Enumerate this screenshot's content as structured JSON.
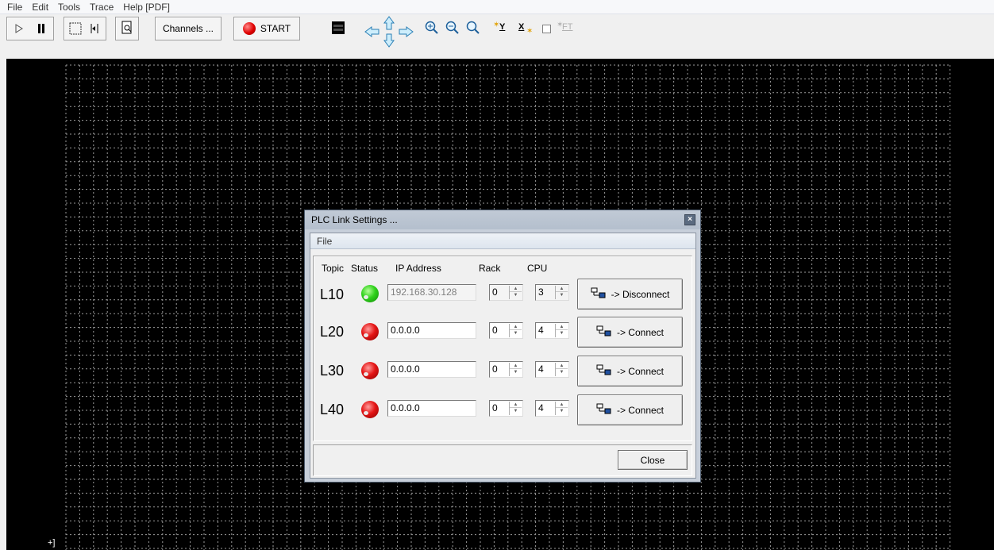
{
  "menu": {
    "items": [
      "File",
      "Edit",
      "Tools",
      "Trace",
      "Help [PDF]"
    ]
  },
  "toolbar": {
    "channels_label": "Channels ...",
    "start_label": "START",
    "y_label": "Y",
    "x_label": "X",
    "ft_label": "FT"
  },
  "plot": {
    "corner_label": "+]"
  },
  "dialog": {
    "title": "PLC Link Settings ...",
    "menu_file": "File",
    "headers": {
      "topic": "Topic",
      "status": "Status",
      "ip": "IP Address",
      "rack": "Rack",
      "cpu": "CPU"
    },
    "rows": [
      {
        "topic": "L10",
        "status": "connected",
        "ip": "192.168.30.128",
        "rack": "0",
        "cpu": "3",
        "button": "-> Disconnect"
      },
      {
        "topic": "L20",
        "status": "disconnected",
        "ip": "0.0.0.0",
        "rack": "0",
        "cpu": "4",
        "button": "-> Connect"
      },
      {
        "topic": "L30",
        "status": "disconnected",
        "ip": "0.0.0.0",
        "rack": "0",
        "cpu": "4",
        "button": "-> Connect"
      },
      {
        "topic": "L40",
        "status": "disconnected",
        "ip": "0.0.0.0",
        "rack": "0",
        "cpu": "4",
        "button": "-> Connect"
      }
    ],
    "close_label": "Close",
    "colors": {
      "connected": "#30d21c",
      "disconnected": "#e51515"
    }
  }
}
